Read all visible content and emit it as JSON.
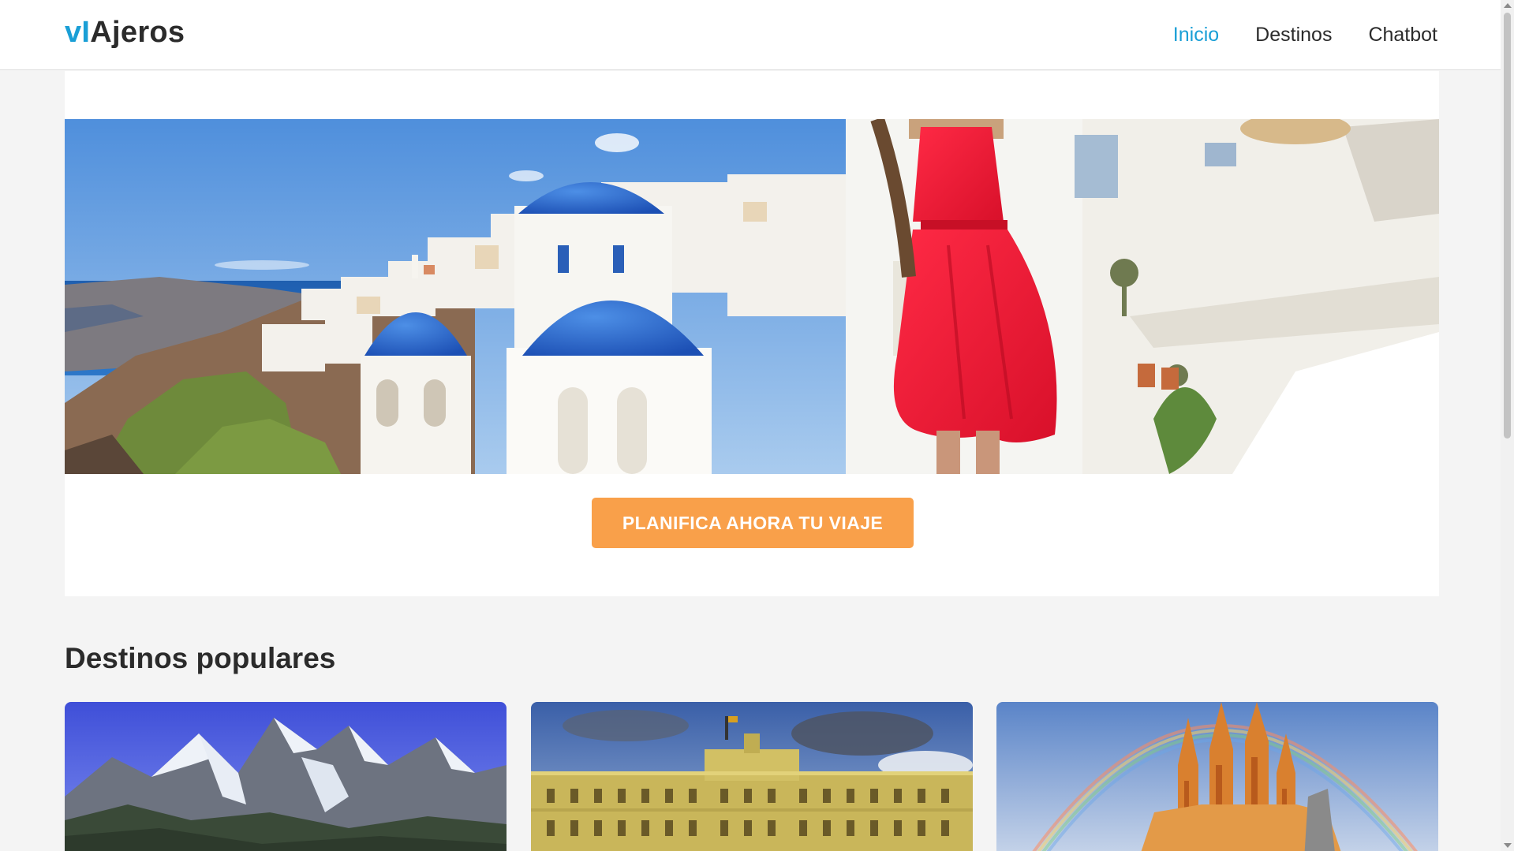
{
  "brand": {
    "part1": "vI",
    "part2": "Ajeros",
    "accent": "#1a9fd6"
  },
  "nav": {
    "items": [
      "Inicio",
      "Destinos",
      "Chatbot"
    ],
    "active": "Inicio"
  },
  "hero": {
    "cta_label": "PLANIFICA AHORA TU VIAJE",
    "cta_color": "#f9a04a"
  },
  "destinations": {
    "title": "Destinos populares"
  }
}
